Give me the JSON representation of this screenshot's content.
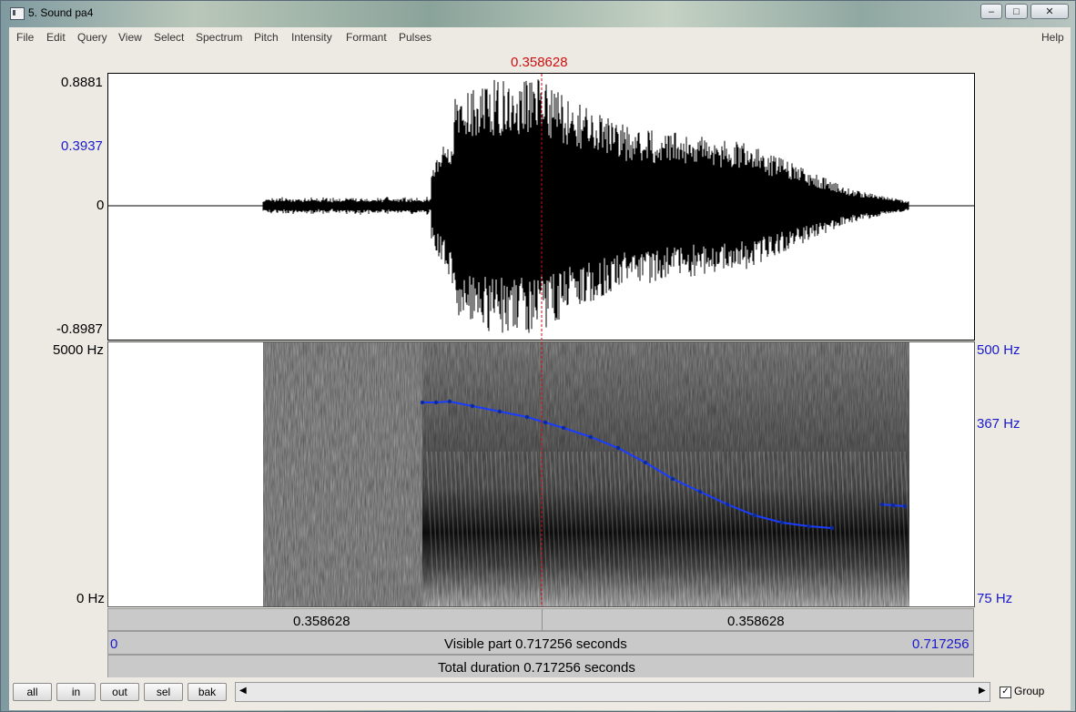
{
  "window": {
    "title": "5. Sound pa4",
    "controls": [
      "minimize-icon",
      "maximize-icon",
      "close-icon"
    ]
  },
  "menu": {
    "items": [
      "File",
      "Edit",
      "Query",
      "View",
      "Select",
      "Spectrum",
      "Pitch",
      "Intensity",
      "Formant",
      "Pulses"
    ],
    "help": "Help"
  },
  "cursor": {
    "time": "0.358628",
    "color": "#cc1111"
  },
  "waveform": {
    "y_max": "0.8881",
    "y_marker": "0.3937",
    "y_zero": "0",
    "y_min": "-0.8987"
  },
  "spectrogram": {
    "freq_top": "5000 Hz",
    "freq_bottom": "0 Hz",
    "pitch_top": "500 Hz",
    "pitch_mid": "367 Hz",
    "pitch_bottom": "75 Hz",
    "pitch_color": "#1a3cff"
  },
  "time_bars": {
    "left_segment": "0.358628",
    "right_segment": "0.358628",
    "visible_start": "0",
    "visible_label": "Visible part 0.717256 seconds",
    "visible_end": "0.717256",
    "total_label": "Total duration 0.717256 seconds"
  },
  "bottom": {
    "buttons": [
      "all",
      "in",
      "out",
      "sel",
      "bak"
    ],
    "group_label": "Group",
    "group_checked": true
  }
}
